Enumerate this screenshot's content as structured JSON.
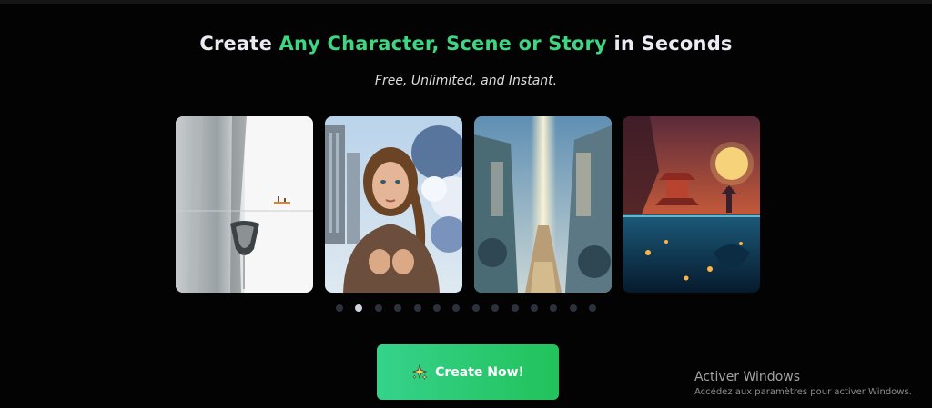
{
  "hero": {
    "headline_prefix": "Create ",
    "headline_accent": "Any Character, Scene or Story",
    "headline_suffix": " in Seconds",
    "subtitle": "Free, Unlimited, and Instant.",
    "accent_color": "#3fd581"
  },
  "carousel": {
    "cards": [
      {
        "subject": "ink boat on calm water",
        "icon": "boat-image"
      },
      {
        "subject": "woman in brown sweater with city and blossom",
        "icon": "portrait-image"
      },
      {
        "subject": "fantasy canyon city with light beam",
        "icon": "canyon-image"
      },
      {
        "subject": "asian pagoda under full moon and underwater scene",
        "icon": "pagoda-image"
      }
    ],
    "dot_count": 14,
    "active_dot": 1
  },
  "cta": {
    "label": "Create Now!",
    "icon": "sparkle-icon",
    "colors": [
      "#35d28b",
      "#22c25b"
    ]
  },
  "os_watermark": {
    "title": "Activer Windows",
    "subtitle": "Accédez aux paramètres pour activer Windows."
  }
}
